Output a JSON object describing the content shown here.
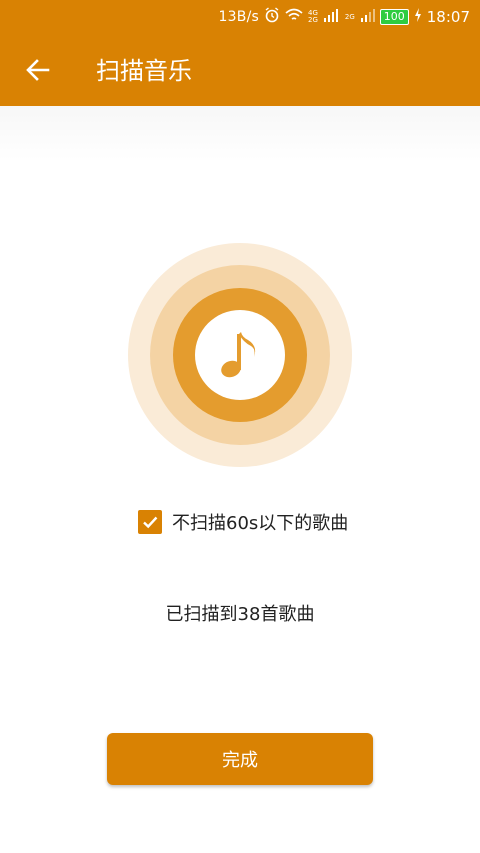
{
  "status_bar": {
    "net_speed": "13B/s",
    "signal_4g": "4G",
    "signal_2g": "2G",
    "signal_2g_b": "2G",
    "battery": "100",
    "time": "18:07"
  },
  "header": {
    "title": "扫描音乐",
    "back_icon": "arrow-left-icon"
  },
  "scan": {
    "icon": "music-note-icon",
    "filter_label": "不扫描60s以下的歌曲",
    "filter_checked": true,
    "result_text": "已扫描到38首歌曲"
  },
  "actions": {
    "done_label": "完成"
  },
  "colors": {
    "accent": "#D98203",
    "ring_outer": "#FAEBD7",
    "ring_mid": "#F4D3A4",
    "ring_inner": "#E49C2E"
  }
}
